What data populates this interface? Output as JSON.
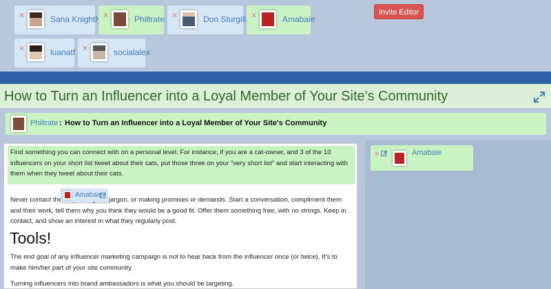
{
  "editors": [
    {
      "name": "Sana Knightly",
      "state": "inactive",
      "remove_icon": "close-icon"
    },
    {
      "name": "Philtrate",
      "state": "active",
      "remove_icon": "close-icon"
    },
    {
      "name": "Don Sturgill",
      "state": "inactive",
      "remove_icon": "close-icon"
    },
    {
      "name": "Amabaie",
      "state": "active",
      "remove_icon": "close-icon"
    },
    {
      "name": "luanatf",
      "state": "inactive",
      "remove_icon": "close-icon"
    },
    {
      "name": "socialalex",
      "state": "inactive",
      "remove_icon": "close-icon"
    }
  ],
  "toolbar": {
    "invite_label": "Invite Editor"
  },
  "colors": {
    "active_chip": "#c9f3c3",
    "inactive_chip": "#d6e6f5",
    "accent_bar": "#2e62a7",
    "danger": "#d9534f",
    "link": "#3f7fbe",
    "title": "#2f6a2a"
  },
  "page": {
    "title": "How to Turn an Influencer into a Loyal Member of Your Site's Community"
  },
  "header": {
    "author": "Philtrate",
    "separator": ":",
    "title": "How to Turn an Influencer into a Loyal Member of Your Site's Community"
  },
  "doc": {
    "p1": "Find something you can connect with on a personal level.  For instance, if you are a cat-owner, and 3 of the 10 influencers on your short list tweet about their cats, put those three on your \"very short list\" and start interacting with them when they tweet about their cats.",
    "p2": "Never contact them speaking PR jargon, or making promises or demands. Start a conversation, compliment them and their work, tell them why you think they would be a good fit. Offer them something free, with no strings. Keep in contact, and show an interest in what they regularly post.",
    "heading": "Tools!",
    "p3": "The end goal of any influencer marketing campaign is not to hear back from the influencer once (or twice). It's to make him/her part of your site community.",
    "p4": "Turning influencers into brand ambassadors is what you should be targeting."
  },
  "cursor": {
    "name": "Amabaie",
    "edit_icon": "edit-icon"
  },
  "side": {
    "name": "Amabaie",
    "remove_icon": "close-icon",
    "edit_icon": "edit-icon"
  },
  "icons": {
    "expand": "expand-icon"
  }
}
